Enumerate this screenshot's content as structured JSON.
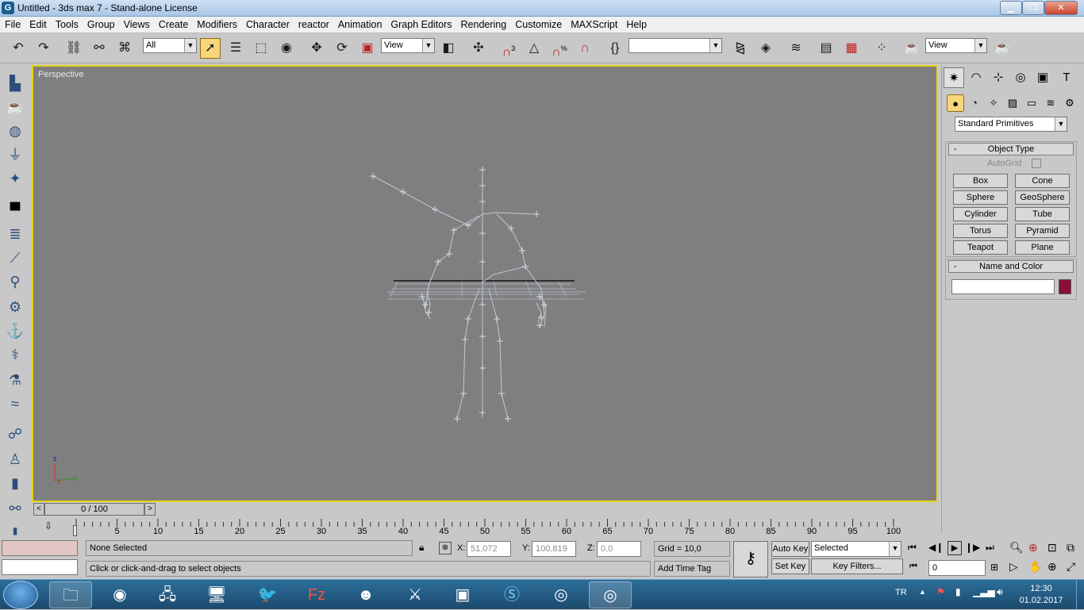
{
  "window": {
    "title": "Untitled - 3ds max 7 - Stand-alone License",
    "app_icon": "3ds-max-icon"
  },
  "menu": [
    "File",
    "Edit",
    "Tools",
    "Group",
    "Views",
    "Create",
    "Modifiers",
    "Character",
    "reactor",
    "Animation",
    "Graph Editors",
    "Rendering",
    "Customize",
    "MAXScript",
    "Help"
  ],
  "toolbar": {
    "selection_filter": "All",
    "ref_coord": "View",
    "named_sel": "",
    "render_view": "View",
    "snap_3": "3",
    "snap_pct": "%"
  },
  "viewport": {
    "label": "Perspective",
    "axis_labels": {
      "z": "z",
      "x": "x",
      "y": "y"
    }
  },
  "command_panel": {
    "category": "Standard Primitives",
    "object_type": {
      "title": "Object Type",
      "autogrid": "AutoGrid",
      "buttons": [
        "Box",
        "Cone",
        "Sphere",
        "GeoSphere",
        "Cylinder",
        "Tube",
        "Torus",
        "Pyramid",
        "Teapot",
        "Plane"
      ]
    },
    "name_color": {
      "title": "Name and Color",
      "name_value": "",
      "color": "#8a0f36"
    }
  },
  "timeline": {
    "frame": "0 / 100",
    "ticks": [
      "5",
      "10",
      "15",
      "20",
      "25",
      "30",
      "35",
      "40",
      "45",
      "50",
      "55",
      "60",
      "65",
      "70",
      "75",
      "80",
      "85",
      "90",
      "95",
      "100"
    ],
    "first": "0"
  },
  "status": {
    "selection": "None Selected",
    "prompt": "Click or click-and-drag to select objects",
    "x_label": "X:",
    "x": "51,072",
    "y_label": "Y:",
    "y": "100,819",
    "z_label": "Z:",
    "z": "0,0",
    "grid": "Grid = 10,0",
    "add_time_tag": "Add Time Tag",
    "auto_key": "Auto Key",
    "set_key": "Set Key",
    "key_mode": "Selected",
    "key_filters": "Key Filters...",
    "frame_field": "0"
  },
  "taskbar": {
    "lang": "TR",
    "time": "12:30",
    "date": "01.02.2017"
  }
}
